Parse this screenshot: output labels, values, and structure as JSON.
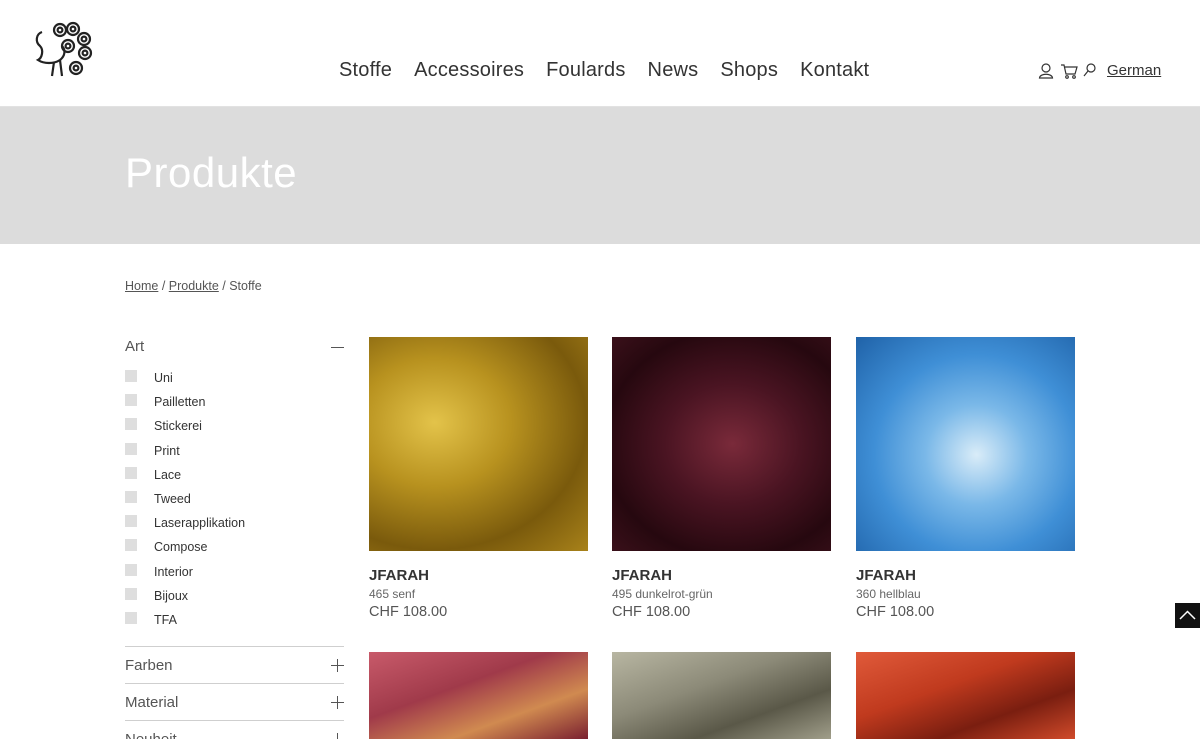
{
  "header": {
    "nav": [
      "Stoffe",
      "Accessoires",
      "Foulards",
      "News",
      "Shops",
      "Kontakt"
    ],
    "icons": [
      "user-icon",
      "cart-icon",
      "search-icon"
    ],
    "language": "German"
  },
  "banner": {
    "title": "Produkte"
  },
  "breadcrumb": {
    "home": "Home",
    "sep1": " / ",
    "produkte": "Produkte",
    "sep2": " / ",
    "current": "Stoffe"
  },
  "sidebar": {
    "art": {
      "label": "Art",
      "options": [
        "Uni",
        "Pailletten",
        "Stickerei",
        "Print",
        "Lace",
        "Tweed",
        "Laserapplikation",
        "Compose",
        "Interior",
        "Bijoux",
        "TFA"
      ]
    },
    "sections": [
      "Farben",
      "Material",
      "Neuheit"
    ]
  },
  "products": [
    {
      "name": "JFARAH",
      "variant": "465 senf",
      "price": "CHF 108.00",
      "color": "#b8921f"
    },
    {
      "name": "JFARAH",
      "variant": "495 dunkelrot-grün",
      "price": "CHF 108.00",
      "color": "#4a1422"
    },
    {
      "name": "JFARAH",
      "variant": "360 hellblau",
      "price": "CHF 108.00",
      "color": "#3f8fd6"
    },
    {
      "name": "",
      "variant": "",
      "price": "",
      "color": "#a03a4a"
    },
    {
      "name": "",
      "variant": "",
      "price": "",
      "color": "#8c8a78"
    },
    {
      "name": "",
      "variant": "",
      "price": "",
      "color": "#c03a1e"
    }
  ]
}
